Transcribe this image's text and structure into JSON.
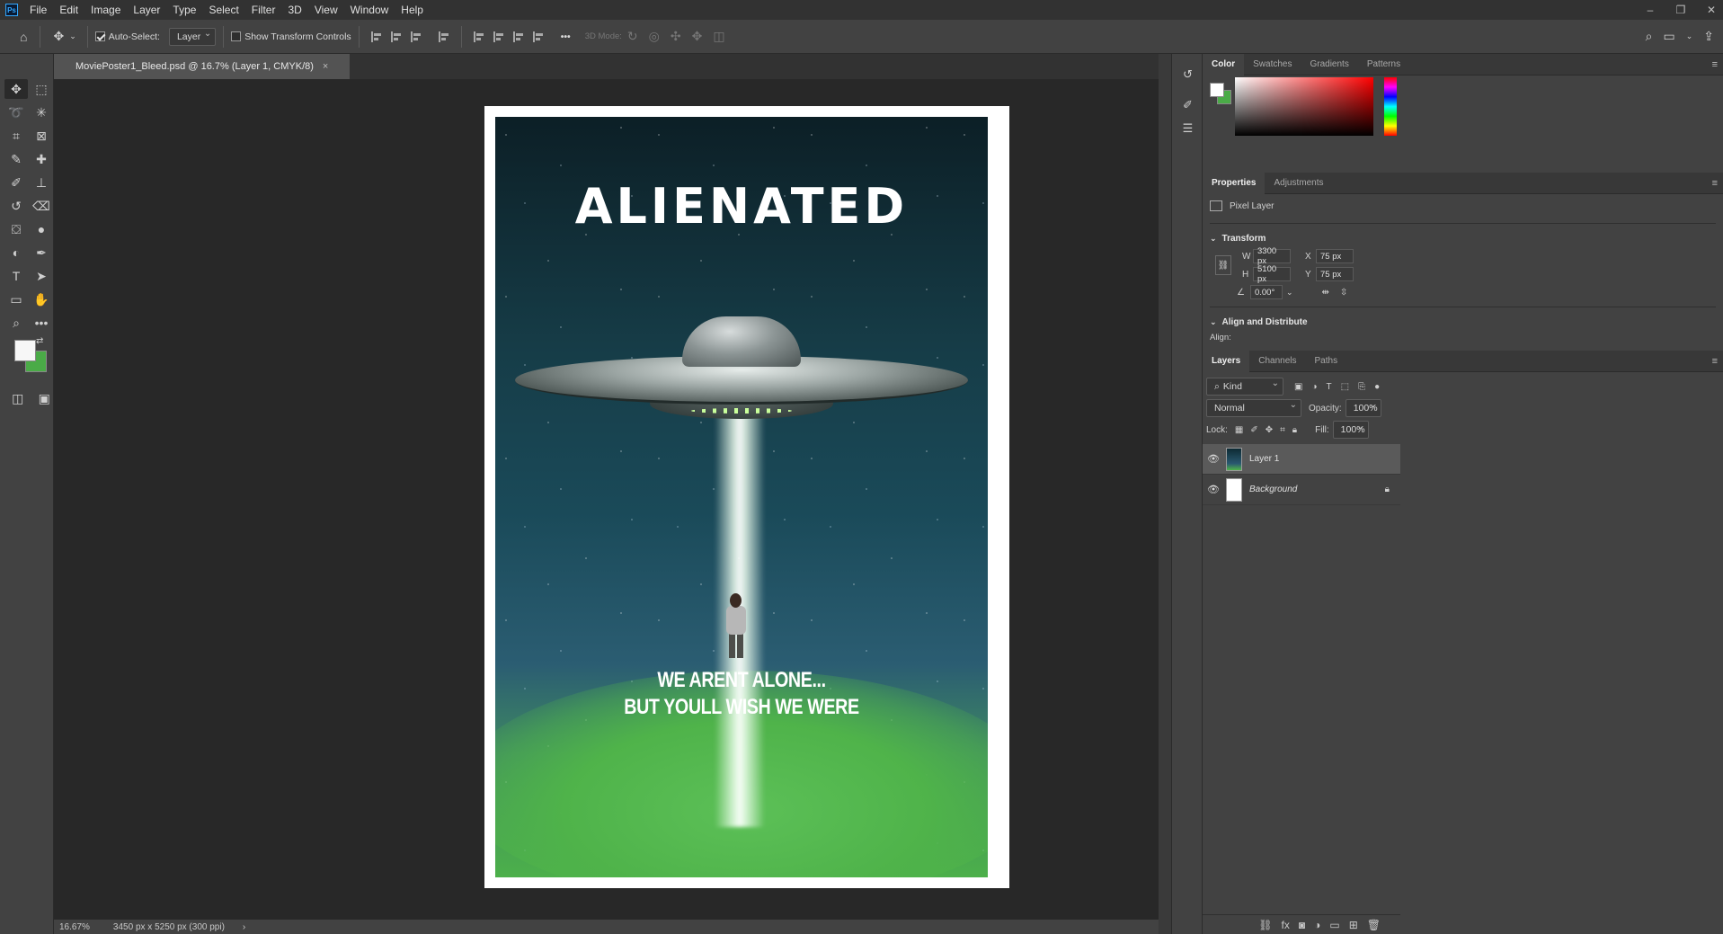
{
  "app": {
    "logo": "Ps",
    "logo_icon": "photoshop-logo-icon"
  },
  "menu": [
    "File",
    "Edit",
    "Image",
    "Layer",
    "Type",
    "Select",
    "Filter",
    "3D",
    "View",
    "Window",
    "Help"
  ],
  "window_controls": {
    "minimize": "–",
    "restore": "❐",
    "close": "✕"
  },
  "options_bar": {
    "auto_select_label": "Auto-Select:",
    "auto_select_checked": true,
    "auto_select_target": "Layer",
    "show_transform_label": "Show Transform Controls",
    "show_transform_checked": false,
    "more_label": "•••",
    "mode_3d_label": "3D Mode:"
  },
  "document": {
    "tab_title": "MoviePoster1_Bleed.psd @ 16.7% (Layer 1, CMYK/8)",
    "close": "×",
    "poster_title": "ALIENATED",
    "tagline_line1": "WE ARENT ALONE...",
    "tagline_line2": "BUT YOULL WISH WE WERE"
  },
  "status_bar": {
    "zoom": "16.67%",
    "doc_size": "3450 px x 5250 px (300 ppi)",
    "arrow": "›"
  },
  "colors": {
    "foreground": "#f7f7f7",
    "background": "#4aab47",
    "accent_green": "#4cb04a"
  },
  "color_panel": {
    "tabs": [
      "Color",
      "Swatches",
      "Gradients",
      "Patterns"
    ],
    "active": "Color"
  },
  "properties_panel": {
    "tabs": [
      "Properties",
      "Adjustments"
    ],
    "active": "Properties",
    "layer_type": "Pixel Layer",
    "transform_heading": "Transform",
    "w_label": "W",
    "w_value": "3300 px",
    "h_label": "H",
    "h_value": "5100 px",
    "x_label": "X",
    "x_value": "75 px",
    "y_label": "Y",
    "y_value": "75 px",
    "angle_value": "0.00°",
    "align_heading": "Align and Distribute",
    "align_label": "Align:"
  },
  "layers_panel": {
    "tabs": [
      "Layers",
      "Channels",
      "Paths"
    ],
    "active": "Layers",
    "filter_kind": "Kind",
    "blend_mode": "Normal",
    "opacity_label": "Opacity:",
    "opacity_value": "100%",
    "lock_label": "Lock:",
    "fill_label": "Fill:",
    "fill_value": "100%",
    "layers": [
      {
        "name": "Layer 1",
        "visible": true,
        "selected": true,
        "locked": false
      },
      {
        "name": "Background",
        "visible": true,
        "selected": false,
        "locked": true
      }
    ]
  }
}
